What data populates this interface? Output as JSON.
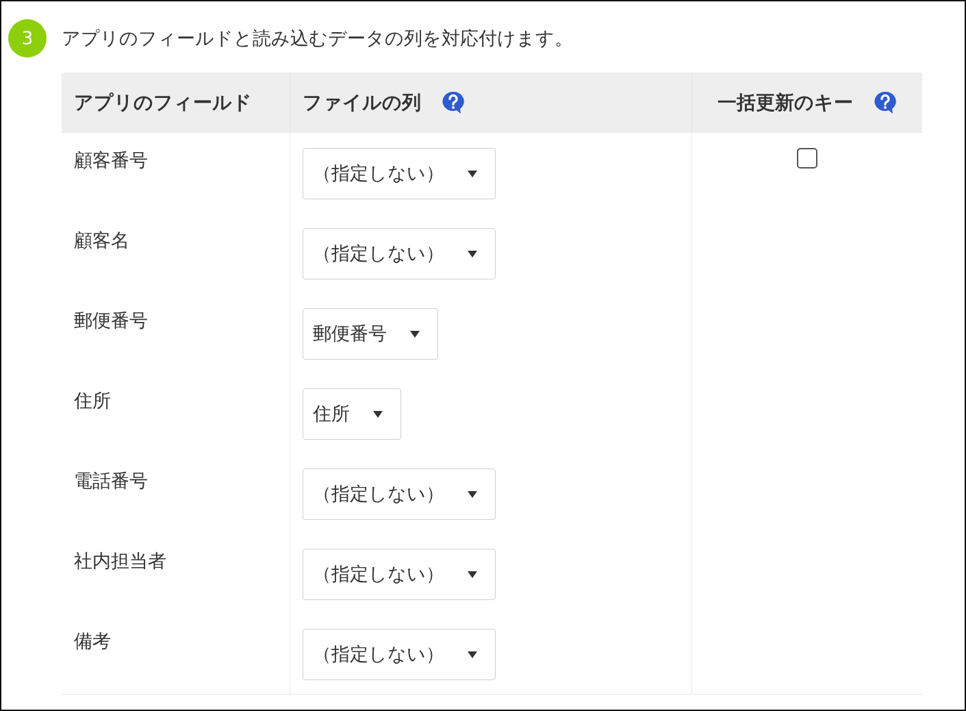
{
  "step": {
    "number": "3",
    "text": "アプリのフィールドと読み込むデータの列を対応付けます。"
  },
  "table": {
    "columns": [
      {
        "label": "アプリのフィールド",
        "help": false
      },
      {
        "label": "ファイルの列",
        "help": true
      },
      {
        "label": "一括更新のキー",
        "help": true
      }
    ],
    "rows": [
      {
        "field": "顧客番号",
        "column": "（指定しない）",
        "key_checkbox": {
          "checked": false
        }
      },
      {
        "field": "顧客名",
        "column": "（指定しない）"
      },
      {
        "field": "郵便番号",
        "column": "郵便番号"
      },
      {
        "field": "住所",
        "column": "住所"
      },
      {
        "field": "電話番号",
        "column": "（指定しない）"
      },
      {
        "field": "社内担当者",
        "column": "（指定しない）"
      },
      {
        "field": "備考",
        "column": "（指定しない）"
      }
    ]
  }
}
